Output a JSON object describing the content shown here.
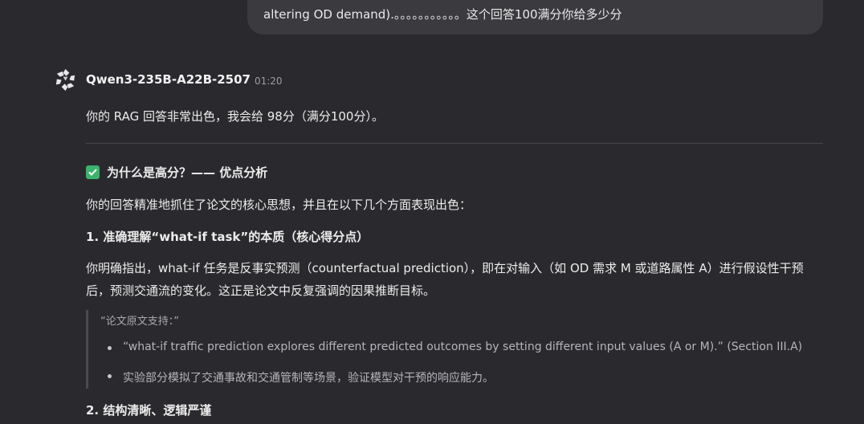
{
  "user_message": {
    "text": "altering OD demand).。。。。。。。。。。。这个回答100满分你给多少分"
  },
  "assistant": {
    "model_name": "Qwen3-235B-A22B-2507",
    "time": "01:20",
    "intro": "你的 RAG 回答非常出色，我会给 98分（满分100分）。",
    "section_title": "为什么是高分？—— 优点分析",
    "section_intro": "你的回答精准地抓住了论文的核心思想，并且在以下几个方面表现出色：",
    "point1_title": "1. 准确理解“what-if task”的本质（核心得分点）",
    "point1_body": "你明确指出，what-if 任务是反事实预测（counterfactual prediction），即在对输入（如 OD 需求 M 或道路属性 A）进行假设性干预后，预测交通流的变化。这正是论文中反复强调的因果推断目标。",
    "quote_head": "“论文原文支持：”",
    "quote_items": [
      "“what-if traffic prediction explores different predicted outcomes by setting different input values (A or M).” (Section III.A)",
      "实验部分模拟了交通事故和交通管制等场景，验证模型对干预的响应能力。"
    ],
    "point2_title": "2. 结构清晰、逻辑严谨"
  },
  "icons": {
    "model_logo": "qwen-logo-icon",
    "check": "check-mark-icon"
  },
  "colors": {
    "background": "#2a2a2e",
    "user_bubble": "#3a3a3f",
    "check_green": "#3bb36d"
  }
}
